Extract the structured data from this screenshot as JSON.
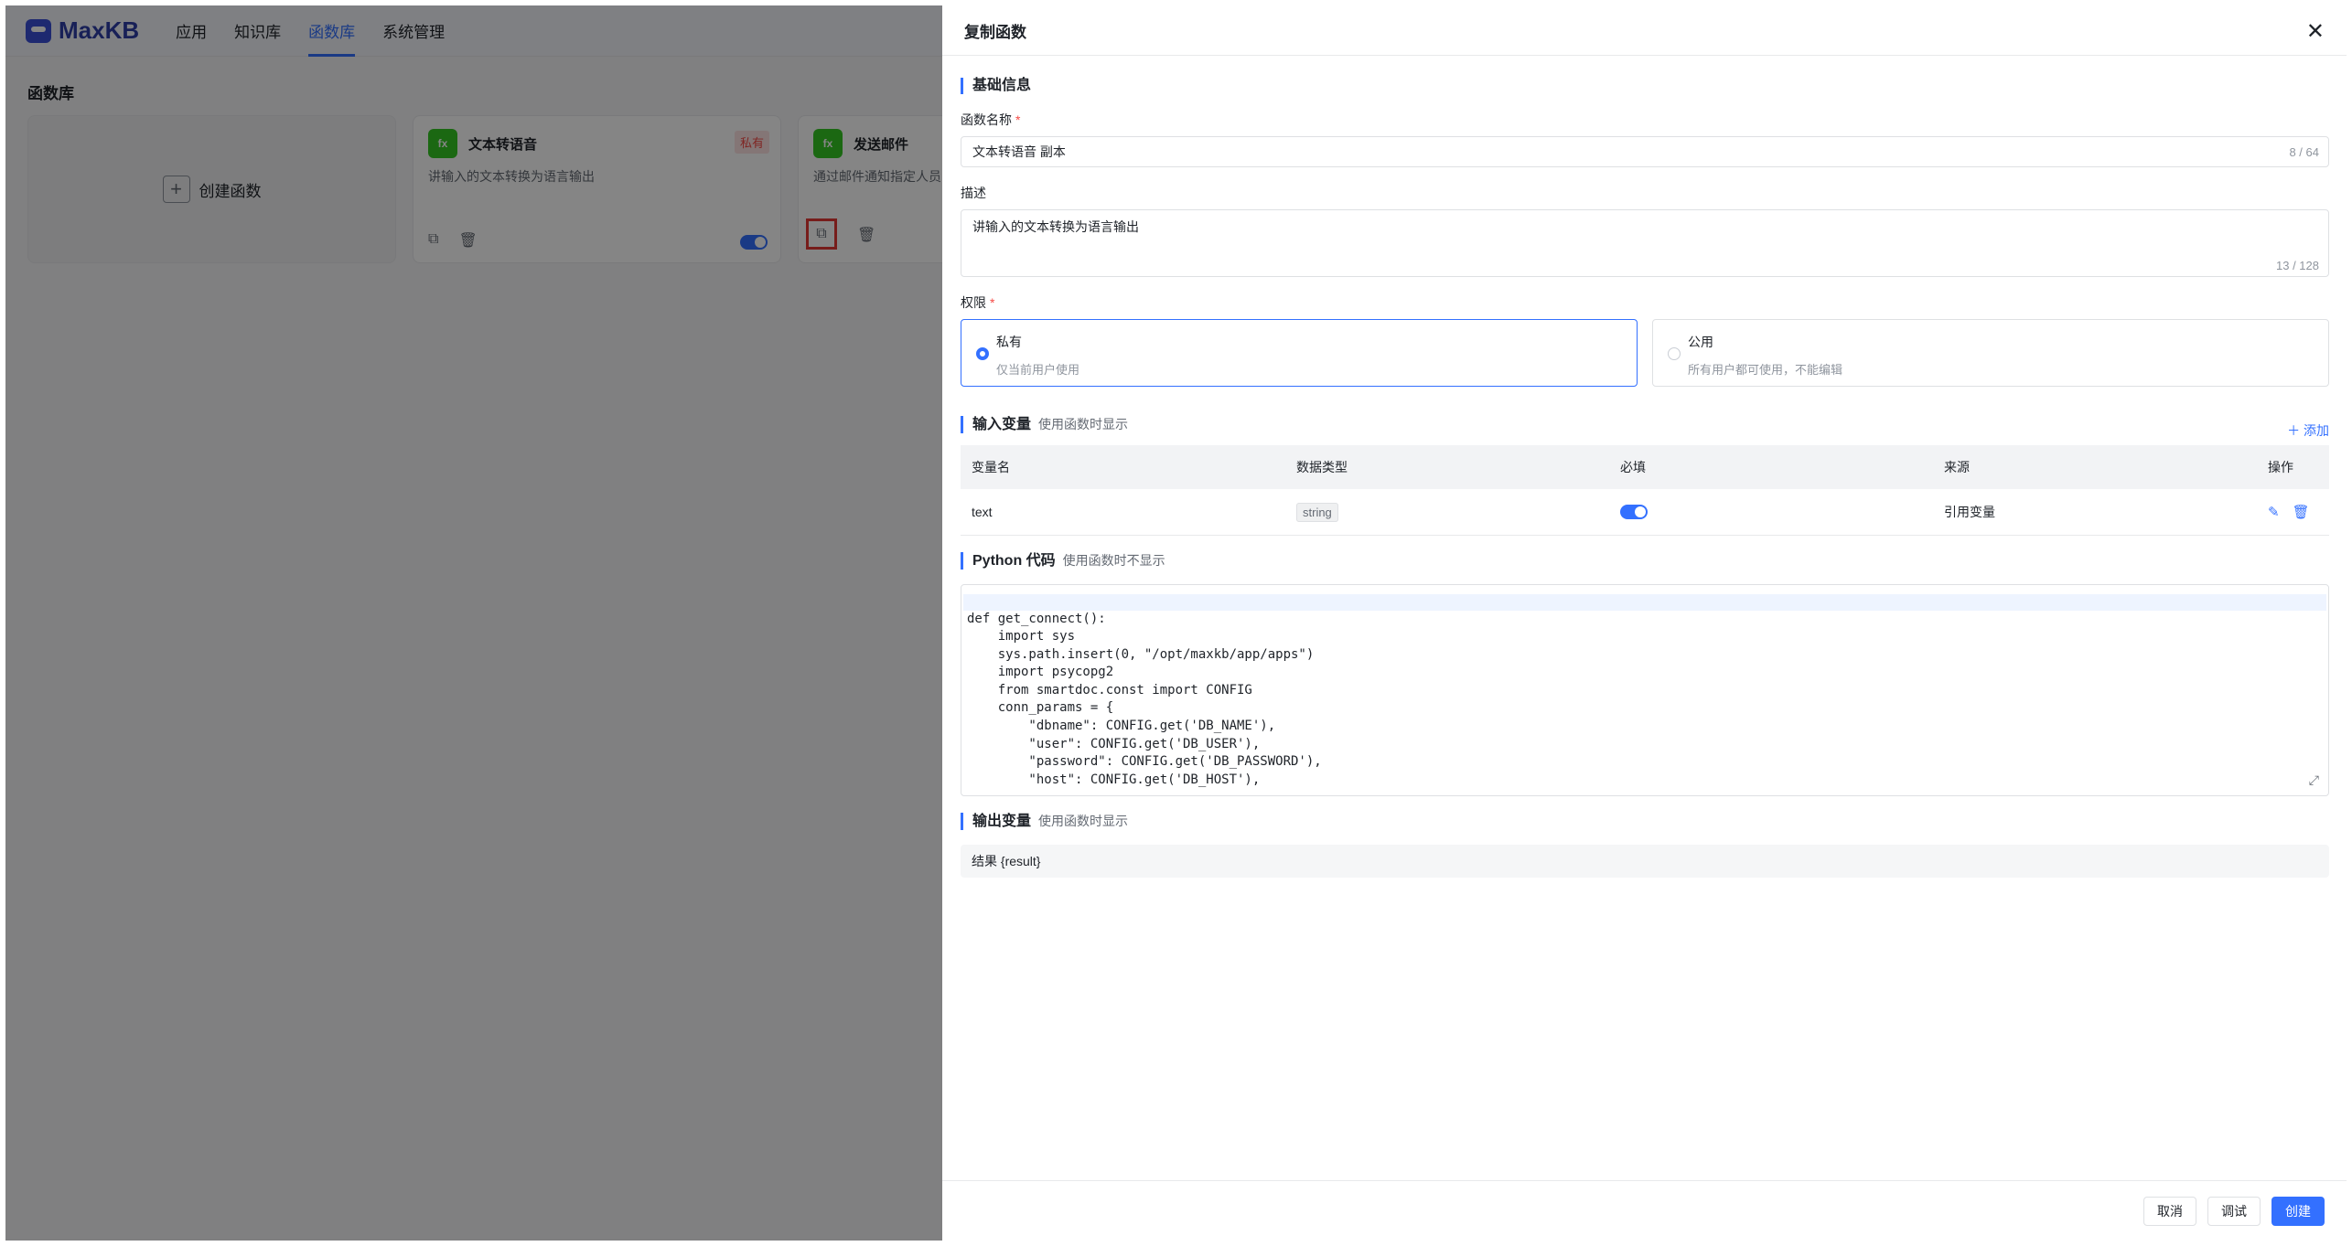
{
  "app": {
    "logo_text": "MaxKB",
    "nav": [
      "应用",
      "知识库",
      "函数库",
      "系统管理"
    ],
    "active_nav": 2,
    "page_title": "函数库",
    "create_label": "创建函数",
    "cards": [
      {
        "name": "文本转语音",
        "desc": "讲输入的文本转换为语言输出",
        "badge": "私有",
        "icon": "fx"
      },
      {
        "name": "发送邮件",
        "desc": "通过邮件通知指定人员",
        "icon": "fx"
      }
    ]
  },
  "drawer": {
    "title": "复制函数",
    "basic_section": "基础信息",
    "name_label": "函数名称",
    "name_value": "文本转语音 副本",
    "name_counter": "8 / 64",
    "desc_label": "描述",
    "desc_value": "讲输入的文本转换为语言输出",
    "desc_counter": "13 / 128",
    "permission_label": "权限",
    "permissions": [
      {
        "title": "私有",
        "desc": "仅当前用户使用",
        "selected": true
      },
      {
        "title": "公用",
        "desc": "所有用户都可使用，不能编辑",
        "selected": false
      }
    ],
    "input_section": "输入变量",
    "input_sub": "使用函数时显示",
    "add_label": "添加",
    "columns": [
      "变量名",
      "数据类型",
      "必填",
      "来源",
      "操作"
    ],
    "rows": [
      {
        "name": "text",
        "type": "string",
        "required": true,
        "source": "引用变量"
      }
    ],
    "code_section": "Python 代码",
    "code_sub": "使用函数时不显示",
    "code": "def get_connect():\n    import sys\n    sys.path.insert(0, \"/opt/maxkb/app/apps\")\n    import psycopg2\n    from smartdoc.const import CONFIG\n    conn_params = {\n        \"dbname\": CONFIG.get('DB_NAME'),\n        \"user\": CONFIG.get('DB_USER'),\n        \"password\": CONFIG.get('DB_PASSWORD'),\n        \"host\": CONFIG.get('DB_HOST'),",
    "output_section": "输出变量",
    "output_sub": "使用函数时显示",
    "output_value": "结果 {result}",
    "cancel_label": "取消",
    "debug_label": "调试",
    "create_label": "创建"
  }
}
